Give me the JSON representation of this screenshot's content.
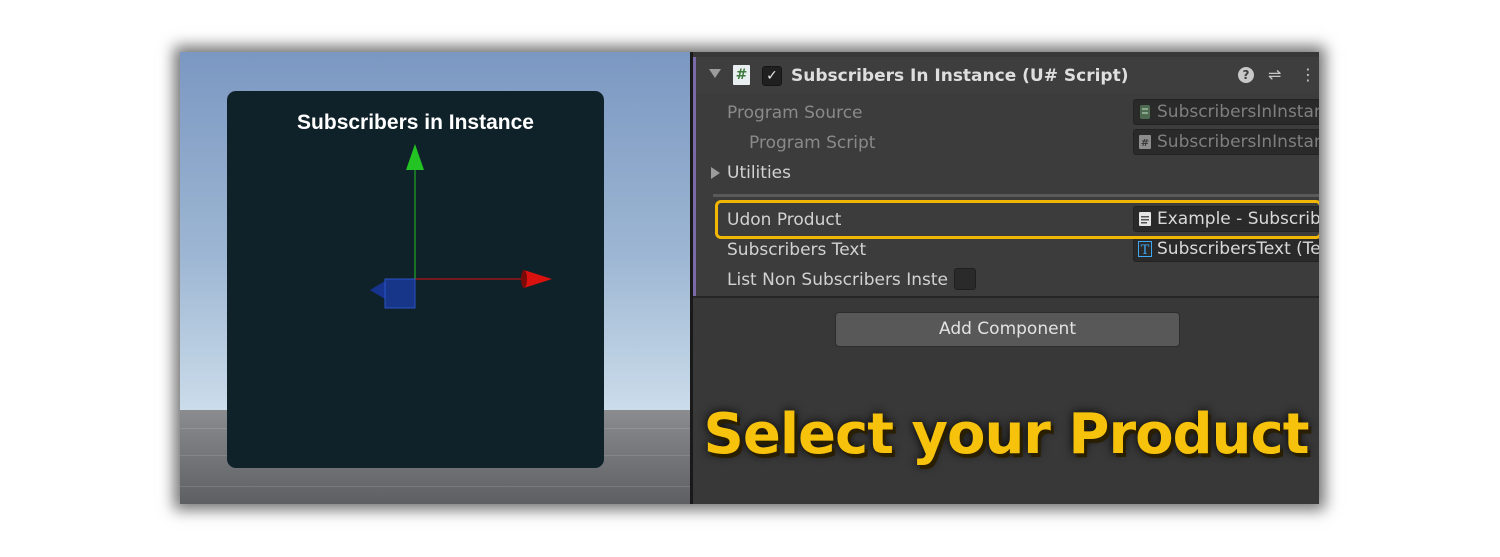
{
  "scene": {
    "canvas_title": "Subscribers in Instance"
  },
  "inspector": {
    "component": {
      "title": "Subscribers In Instance (U# Script)",
      "script_icon": "#",
      "enabled_check": "✓",
      "help_icon": "?",
      "settings_icon": "⇌",
      "menu_icon": "⋮"
    },
    "fields": {
      "program_source": {
        "label": "Program Source",
        "value": "SubscribersInInstance Udon C# Program Asset"
      },
      "program_script": {
        "label": "Program Script",
        "value": "SubscribersInInstance"
      },
      "utilities": {
        "label": "Utilities"
      },
      "udon_product": {
        "label": "Udon Product",
        "value": "Example - Subscriber (UdonProduct)"
      },
      "subscribers_text": {
        "label": "Subscribers Text",
        "value": "SubscribersText (TextMeshProUGUI)"
      },
      "list_non_subscribers": {
        "label": "List Non Subscribers Instead",
        "checked": false
      }
    },
    "add_component_label": "Add Component"
  },
  "caption": "Select your Product",
  "colors": {
    "highlight": "#f2b705",
    "caption": "#f7c20b",
    "axis_x": "#d9120f",
    "axis_y": "#22c322",
    "axis_z": "#1a3fd0"
  }
}
